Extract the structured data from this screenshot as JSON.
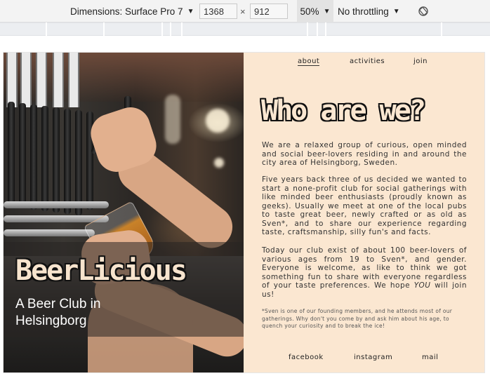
{
  "devtools": {
    "dimensions_label": "Dimensions: Surface Pro 7",
    "width": "1368",
    "times": "×",
    "height": "912",
    "zoom": "50%",
    "throttle": "No throttling",
    "caret": "▼",
    "rotate_icon": "rotate-icon"
  },
  "hero": {
    "brand": "BeerLicious",
    "tagline": "A Beer Club in Helsingborg"
  },
  "nav": {
    "items": [
      "about",
      "activities",
      "join"
    ],
    "active": "about"
  },
  "content": {
    "heading": "Who are we?",
    "p1": "We are a relaxed group of curious, open minded and social beer-lovers residing in and around the city area of Helsingborg, Sweden.",
    "p2": "Five years back three of us decided we wanted to start a none-profit club for social gatherings with like minded beer enthusiasts (proudly known as geeks). Usually we meet at one of the local pubs to taste great beer, newly crafted or as old as Sven*, and to share our experience regarding taste, craftsmanship, silly fun's and facts.",
    "p3_before": "Today our club exist of about 100 beer-lovers of various ages from 19 to Sven*, and gender. Everyone is welcome, as like to think we got something fun to share with everyone regardless of your taste preferences. We hope ",
    "p3_em": "YOU",
    "p3_after": " will join us!",
    "note": "*Sven is one of our founding members, and he attends most of our gatherings. Why don't you come by and ask him about his age, to quench your curiosity and to break the ice!"
  },
  "footer": {
    "items": [
      "facebook",
      "instagram",
      "mail"
    ]
  }
}
